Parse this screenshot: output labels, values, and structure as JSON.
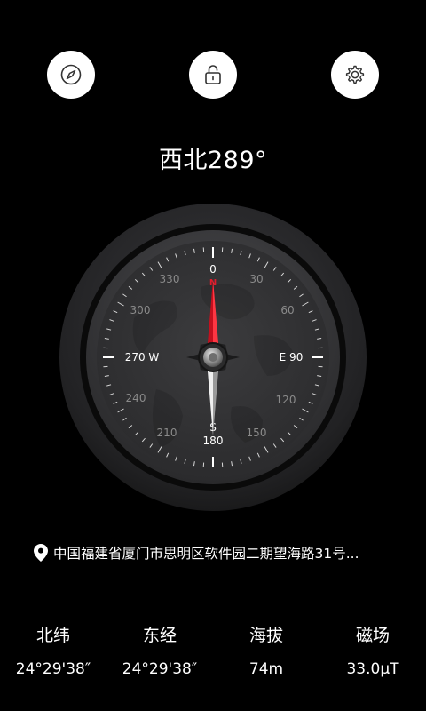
{
  "toolbar": {
    "compass_icon": "compass-icon",
    "lock_icon": "unlock-icon",
    "settings_icon": "gear-icon"
  },
  "heading": "西北289°",
  "compass": {
    "top_label": "0",
    "ticks": [
      "30",
      "60",
      "120",
      "150",
      "210",
      "240",
      "300",
      "330"
    ],
    "east": "E 90",
    "west": "270 W",
    "south_letter": "S",
    "south_deg": "180",
    "north_letter": "N",
    "accent": "#e11c2c"
  },
  "location": {
    "icon": "location-pin-icon",
    "address": "中国福建省厦门市思明区软件园二期望海路31号..."
  },
  "stats": [
    {
      "label": "北纬",
      "value": "24°29'38″"
    },
    {
      "label": "东经",
      "value": "24°29'38″"
    },
    {
      "label": "海拔",
      "value": "74m"
    },
    {
      "label": "磁场",
      "value": "33.0μT"
    }
  ]
}
